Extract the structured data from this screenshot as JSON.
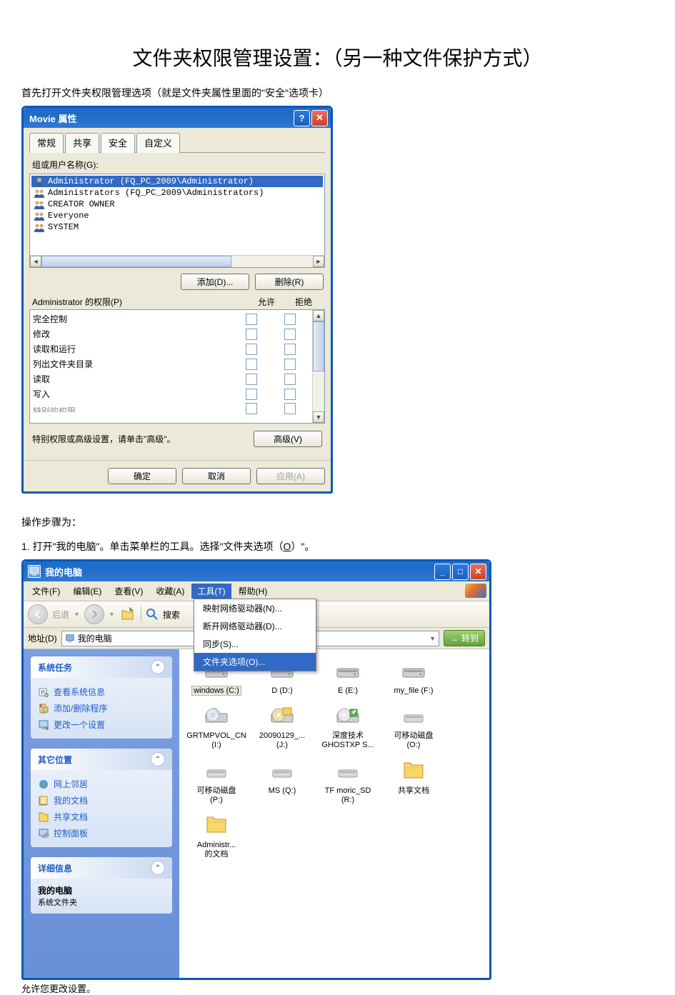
{
  "heading": "文件夹权限管理设置：（另一种文件保护方式）",
  "intro": "首先打开文件夹权限管理选项（就是文件夹属性里面的\"安全\"选项卡）",
  "dialog1": {
    "title": "Movie 属性",
    "tabs": [
      "常规",
      "共享",
      "安全",
      "自定义"
    ],
    "activeTab": 2,
    "groupLabel": "组或用户名称(G):",
    "users": [
      "Administrator (FQ_PC_2009\\Administrator)",
      "Administrators (FQ_PC_2009\\Administrators)",
      "CREATOR OWNER",
      "Everyone",
      "SYSTEM"
    ],
    "addBtn": "添加(D)...",
    "removeBtn": "删除(R)",
    "permLabel": "Administrator 的权限(P)",
    "allow": "允许",
    "deny": "拒绝",
    "perms": [
      "完全控制",
      "修改",
      "读取和运行",
      "列出文件夹目录",
      "读取",
      "写入",
      "特别的权限"
    ],
    "advText": "特别权限或高级设置，请单击\"高级\"。",
    "advBtn": "高级(V)",
    "ok": "确定",
    "cancel": "取消",
    "apply": "应用(A)"
  },
  "steps": {
    "label": "操作步骤为：",
    "s1a": "1.   打开\"我的电脑\"。单击菜单栏的工具。选择\"文件夹选项（",
    "s1u": "O",
    "s1b": "）\"。"
  },
  "explorer": {
    "title": "我的电脑",
    "menu": [
      "文件(F)",
      "编辑(E)",
      "查看(V)",
      "收藏(A)",
      "工具(T)",
      "帮助(H)"
    ],
    "activeMenu": 4,
    "dropdown": [
      "映射网络驱动器(N)...",
      "断开网络驱动器(D)...",
      "同步(S)...",
      "文件夹选项(O)..."
    ],
    "ddSel": 3,
    "back": "后退",
    "search": "搜索",
    "addrLabel": "地址(D)",
    "addrValue": "我的电脑",
    "go": "转到",
    "panels": {
      "sys": {
        "title": "系统任务",
        "links": [
          "查看系统信息",
          "添加/删除程序",
          "更改一个设置"
        ]
      },
      "other": {
        "title": "其它位置",
        "links": [
          "网上邻居",
          "我的文档",
          "共享文档",
          "控制面板"
        ]
      },
      "detail": {
        "title": "详细信息",
        "bold": "我的电脑",
        "sub": "系统文件夹"
      }
    },
    "drives": [
      {
        "l1": "windows (C:)",
        "t": "disk",
        "sel": true
      },
      {
        "l1": "D (D:)",
        "t": "disk"
      },
      {
        "l1": "E (E:)",
        "t": "disk"
      },
      {
        "l1": "my_file (F:)",
        "t": "disk"
      },
      {
        "l1": "GRTMPVOL_CN",
        "l2": "(I:)",
        "t": "cd"
      },
      {
        "l1": "20090129_...",
        "l2": "(J:)",
        "t": "cd2"
      },
      {
        "l1": "深度技术",
        "l2": "GHOSTXP S...",
        "t": "cd3"
      },
      {
        "l1": "可移动磁盘",
        "l2": "(O:)",
        "t": "rem"
      },
      {
        "l1": "可移动磁盘",
        "l2": "(P:)",
        "t": "rem"
      },
      {
        "l1": "MS (Q:)",
        "t": "rem"
      },
      {
        "l1": "TF moric_SD",
        "l2": "(R:)",
        "t": "rem"
      },
      {
        "l1": "共享文档",
        "t": "folder"
      },
      {
        "l1": "Administr...",
        "l2": "的文档",
        "t": "folder"
      }
    ]
  },
  "status": "允许您更改设置。"
}
